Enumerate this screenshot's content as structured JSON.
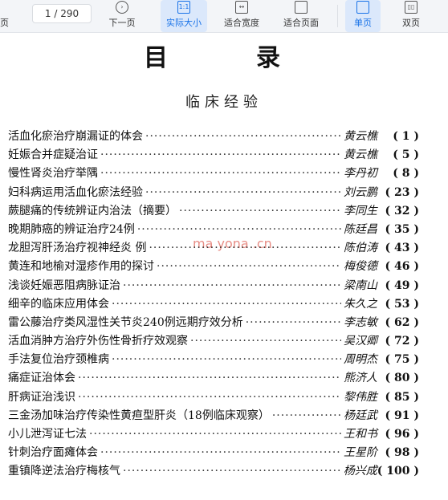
{
  "toolbar": {
    "cut_left_label": "页",
    "page_indicator": "1 / 290",
    "buttons": [
      {
        "label": "下一页",
        "icon": "next-page-icon"
      },
      {
        "label": "实际大小",
        "icon": "actual-size-icon",
        "active": true
      },
      {
        "label": "适合宽度",
        "icon": "fit-width-icon"
      },
      {
        "label": "适合页面",
        "icon": "fit-page-icon"
      },
      {
        "label": "单页",
        "icon": "single-page-icon",
        "active": true
      },
      {
        "label": "双页",
        "icon": "double-page-icon"
      }
    ],
    "accent_color": "#1a73e8"
  },
  "document": {
    "title": "目录",
    "section": "临床经验",
    "watermark": "ma yona .cn",
    "entries": [
      {
        "title": "活血化瘀治疗崩漏证的体会",
        "author": "黄云樵",
        "page": "( 1 )"
      },
      {
        "title": "妊娠合并症疑治证",
        "author": "黄云樵",
        "page": "( 5 )"
      },
      {
        "title": "慢性肾炎治疗举隅",
        "author": "李丹初",
        "page": "( 8 )"
      },
      {
        "title": "妇科病运用活血化瘀法经验",
        "author": "刘云鹏",
        "page": "( 23 )"
      },
      {
        "title": "蕨腿痛的传统辨证内治法（摘要）",
        "author": "李同生",
        "page": "( 32 )"
      },
      {
        "title": "晚期肺癌的辨证治疗24例",
        "author": "陈廷昌",
        "page": "( 35 )"
      },
      {
        "title": "龙胆泻肝汤治疗视神经炎   例",
        "author": "陈伯涛",
        "page": "( 43 )"
      },
      {
        "title": "黄连和地榆对湿疹作用的探讨",
        "author": "梅俊德",
        "page": "( 46 )"
      },
      {
        "title": "浅谈妊娠恶阻病脉证治",
        "author": "梁南山",
        "page": "( 49 )"
      },
      {
        "title": "细辛的临床应用体会",
        "author": "朱久之",
        "page": "( 53 )"
      },
      {
        "title": "雷公藤治疗类风湿性关节炎240例远期疗效分析",
        "author": "李志敏",
        "page": "( 62 )"
      },
      {
        "title": "活血消肿方治疗外伤性骨折疗效观察",
        "author": "吴汉卿",
        "page": "( 72 )"
      },
      {
        "title": "手法复位治疗颈椎病",
        "author": "周明杰",
        "page": "( 75 )"
      },
      {
        "title": "痛症证治体会",
        "author": "熊济人",
        "page": "( 80 )"
      },
      {
        "title": "肝病证治浅识",
        "author": "黎伟胜",
        "page": "( 85 )"
      },
      {
        "title": "三金汤加味治疗传染性黄疸型肝炎（18例临床观察）",
        "author": "杨廷武",
        "page": "( 91 )"
      },
      {
        "title": "小儿泄泻证七法",
        "author": "王和书",
        "page": "( 96 )"
      },
      {
        "title": "针刺治疗面瘫体会",
        "author": "王星阶",
        "page": "( 98 )"
      },
      {
        "title": "重镇降逆法治疗梅核气",
        "author": "杨兴成",
        "page": "( 100 )"
      }
    ]
  }
}
